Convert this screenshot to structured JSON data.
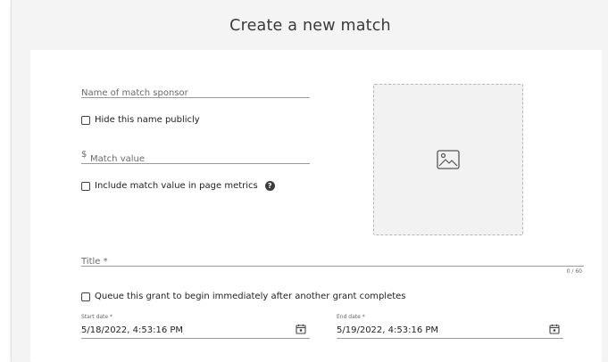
{
  "dialog": {
    "title": "Create a new match"
  },
  "sponsor": {
    "placeholder": "Name of match sponsor"
  },
  "hide_name": {
    "label": "Hide this name publicly",
    "checked": false
  },
  "match_value": {
    "prefix": "$",
    "placeholder": "Match value"
  },
  "include_metrics": {
    "label": "Include match value in page metrics",
    "help": "?",
    "checked": false
  },
  "image_upload": {
    "icon": "image-icon"
  },
  "title_field": {
    "placeholder": "Title *",
    "counter": "0 / 60"
  },
  "queue": {
    "label": "Queue this grant to begin immediately after another grant completes",
    "checked": false
  },
  "start_date": {
    "label": "Start date *",
    "value": "5/18/2022, 4:53:16 PM",
    "icon": "calendar-icon"
  },
  "end_date": {
    "label": "End date *",
    "value": "5/19/2022, 4:53:16 PM",
    "icon": "calendar-icon"
  },
  "colors": {
    "background": "#f4f4f4",
    "card": "#ffffff",
    "underline": "#9a9a9a"
  }
}
